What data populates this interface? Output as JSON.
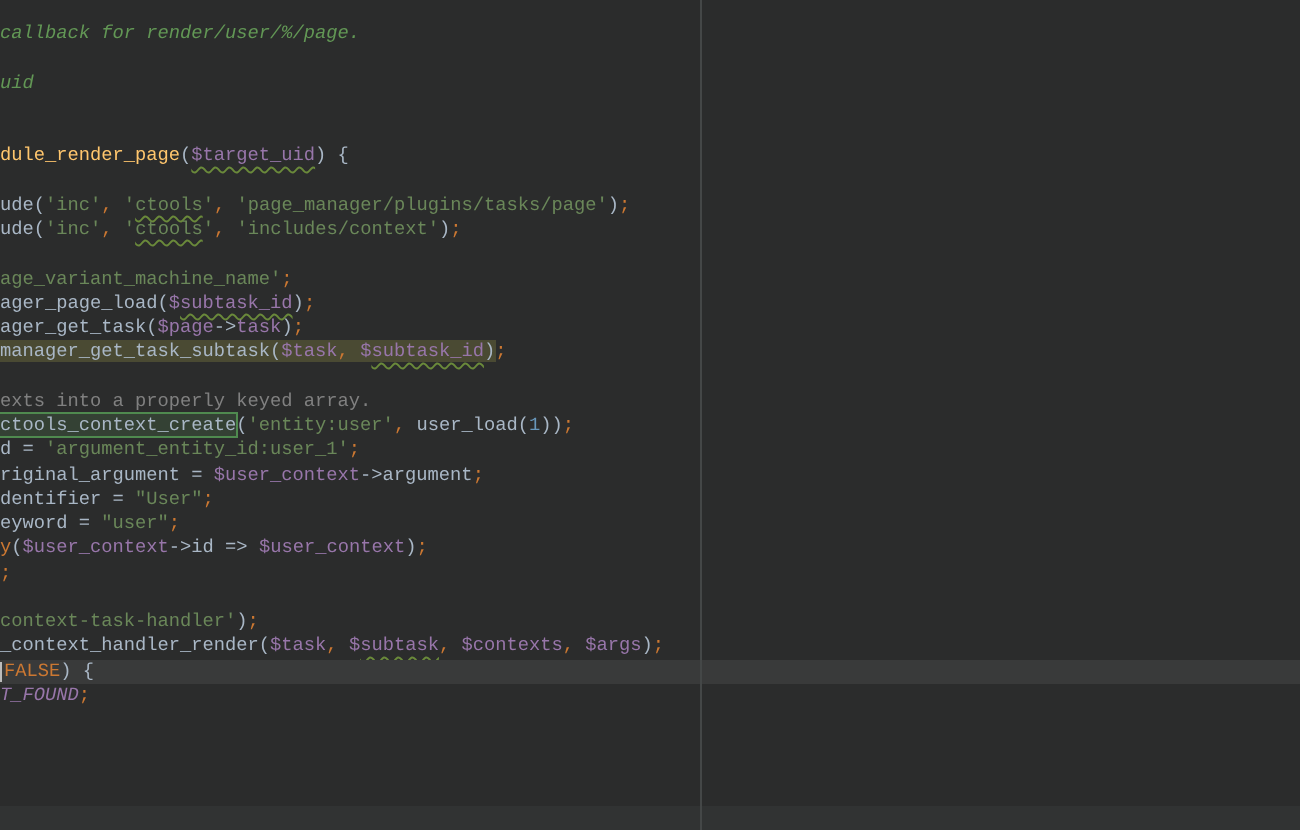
{
  "editor": {
    "lines": [
      {
        "current": false,
        "tokens": [
          {
            "text": "callback for render/user/%/page.",
            "kind": "doc"
          }
        ]
      },
      {
        "current": false
      },
      {
        "current": false,
        "tokens": [
          {
            "text": "uid",
            "kind": "doc"
          }
        ]
      },
      {
        "current": false
      },
      {
        "current": false
      },
      {
        "current": false,
        "tokens": [
          {
            "text": "dule_render_page",
            "kind": "function"
          },
          {
            "text": "(",
            "kind": "plain"
          },
          {
            "text": "$target_uid",
            "kind": "variable",
            "flagged": true
          },
          {
            "text": ") {",
            "kind": "plain"
          }
        ]
      },
      {
        "current": false
      },
      {
        "current": false,
        "tokens": [
          {
            "text": "ude(",
            "kind": "plain"
          },
          {
            "text": "'inc'",
            "kind": "string"
          },
          {
            "text": ", ",
            "kind": "punct"
          },
          {
            "text": "'",
            "kind": "string"
          },
          {
            "text": "ctools",
            "kind": "string",
            "flagged": true
          },
          {
            "text": "'",
            "kind": "string"
          },
          {
            "text": ", ",
            "kind": "punct"
          },
          {
            "text": "'page_manager/plugins/tasks/page'",
            "kind": "string"
          },
          {
            "text": ")",
            "kind": "plain"
          },
          {
            "text": ";",
            "kind": "punct"
          }
        ]
      },
      {
        "current": false,
        "tokens": [
          {
            "text": "ude(",
            "kind": "plain"
          },
          {
            "text": "'inc'",
            "kind": "string"
          },
          {
            "text": ", ",
            "kind": "punct"
          },
          {
            "text": "'",
            "kind": "string"
          },
          {
            "text": "ctools",
            "kind": "string",
            "flagged": true
          },
          {
            "text": "'",
            "kind": "string"
          },
          {
            "text": ", ",
            "kind": "punct"
          },
          {
            "text": "'includes/context'",
            "kind": "string"
          },
          {
            "text": ")",
            "kind": "plain"
          },
          {
            "text": ";",
            "kind": "punct"
          }
        ]
      },
      {
        "current": false
      },
      {
        "current": false,
        "tokens": [
          {
            "text": "age_variant_machine_name'",
            "kind": "string"
          },
          {
            "text": ";",
            "kind": "punct"
          }
        ]
      },
      {
        "current": false,
        "tokens": [
          {
            "text": "ager_page_load(",
            "kind": "plain"
          },
          {
            "text": "$",
            "kind": "variable"
          },
          {
            "text": "subtask_id",
            "kind": "variable",
            "flagged": true
          },
          {
            "text": ")",
            "kind": "plain"
          },
          {
            "text": ";",
            "kind": "punct"
          }
        ]
      },
      {
        "current": false,
        "tokens": [
          {
            "text": "ager_get_task(",
            "kind": "plain"
          },
          {
            "text": "$page",
            "kind": "variable"
          },
          {
            "text": "->",
            "kind": "plain"
          },
          {
            "text": "task",
            "kind": "variable"
          },
          {
            "text": ")",
            "kind": "plain"
          },
          {
            "text": ";",
            "kind": "punct"
          }
        ]
      },
      {
        "current": false,
        "tokens": [
          {
            "text": "manager_get_task_subtask(",
            "kind": "plain",
            "highlighted": true
          },
          {
            "text": "$task",
            "kind": "variable",
            "highlighted": true
          },
          {
            "text": ", ",
            "kind": "punct",
            "highlighted": true
          },
          {
            "text": "$",
            "kind": "variable",
            "highlighted": true
          },
          {
            "text": "subtask_id",
            "kind": "variable",
            "flagged": true,
            "highlighted": true
          },
          {
            "text": ")",
            "kind": "plain",
            "highlighted": true
          },
          {
            "text": ";",
            "kind": "punct",
            "highlighted": false
          }
        ]
      },
      {
        "current": false
      },
      {
        "current": false,
        "tokens": [
          {
            "text": "exts into a properly keyed array.",
            "kind": "comment"
          }
        ]
      },
      {
        "current": false,
        "tokens": [
          {
            "text": "ctools_context_create",
            "kind": "plain",
            "boxed": true
          },
          {
            "text": "(",
            "kind": "plain"
          },
          {
            "text": "'entity:user'",
            "kind": "string"
          },
          {
            "text": ", ",
            "kind": "punct"
          },
          {
            "text": "user_load(",
            "kind": "plain"
          },
          {
            "text": "1",
            "kind": "number"
          },
          {
            "text": "))",
            "kind": "plain"
          },
          {
            "text": ";",
            "kind": "punct"
          }
        ]
      },
      {
        "current": false,
        "tokens": [
          {
            "text": "d = ",
            "kind": "plain"
          },
          {
            "text": "'argument_entity_id:user_1'",
            "kind": "string"
          },
          {
            "text": ";",
            "kind": "punct"
          }
        ]
      },
      {
        "current": false,
        "tokens": [
          {
            "text": "riginal_argument = ",
            "kind": "plain"
          },
          {
            "text": "$user_context",
            "kind": "variable"
          },
          {
            "text": "->argument",
            "kind": "plain"
          },
          {
            "text": ";",
            "kind": "punct"
          }
        ]
      },
      {
        "current": false,
        "tokens": [
          {
            "text": "dentifier = ",
            "kind": "plain"
          },
          {
            "text": "\"User\"",
            "kind": "string"
          },
          {
            "text": ";",
            "kind": "punct"
          }
        ]
      },
      {
        "current": false,
        "tokens": [
          {
            "text": "eyword = ",
            "kind": "plain"
          },
          {
            "text": "\"user\"",
            "kind": "string"
          },
          {
            "text": ";",
            "kind": "punct"
          }
        ]
      },
      {
        "current": false,
        "tokens": [
          {
            "text": "y",
            "kind": "keyword"
          },
          {
            "text": "(",
            "kind": "plain"
          },
          {
            "text": "$user_context",
            "kind": "variable"
          },
          {
            "text": "->id => ",
            "kind": "plain"
          },
          {
            "text": "$user_context",
            "kind": "variable"
          },
          {
            "text": ")",
            "kind": "plain"
          },
          {
            "text": ";",
            "kind": "punct"
          }
        ]
      },
      {
        "current": false,
        "tokens": [
          {
            "text": ";",
            "kind": "punct"
          }
        ]
      },
      {
        "current": false
      },
      {
        "current": false,
        "tokens": [
          {
            "text": "context-task-handler'",
            "kind": "string"
          },
          {
            "text": ")",
            "kind": "plain"
          },
          {
            "text": ";",
            "kind": "punct"
          }
        ]
      },
      {
        "current": false,
        "tokens": [
          {
            "text": "_context_handler_render(",
            "kind": "plain"
          },
          {
            "text": "$task",
            "kind": "variable"
          },
          {
            "text": ", ",
            "kind": "punct"
          },
          {
            "text": "$",
            "kind": "variable"
          },
          {
            "text": "subtask",
            "kind": "variable",
            "flagged": true
          },
          {
            "text": ", ",
            "kind": "punct"
          },
          {
            "text": "$contexts",
            "kind": "variable"
          },
          {
            "text": ", ",
            "kind": "punct"
          },
          {
            "text": "$args",
            "kind": "variable"
          },
          {
            "text": ")",
            "kind": "plain"
          },
          {
            "text": ";",
            "kind": "punct"
          }
        ]
      },
      {
        "current": true,
        "tokens": [
          {
            "text": "FALSE",
            "kind": "keyword"
          },
          {
            "text": ") {",
            "kind": "plain"
          }
        ]
      },
      {
        "current": false,
        "tokens": [
          {
            "text": "T_FOUND",
            "kind": "constant"
          },
          {
            "text": ";",
            "kind": "punct"
          }
        ]
      }
    ]
  }
}
